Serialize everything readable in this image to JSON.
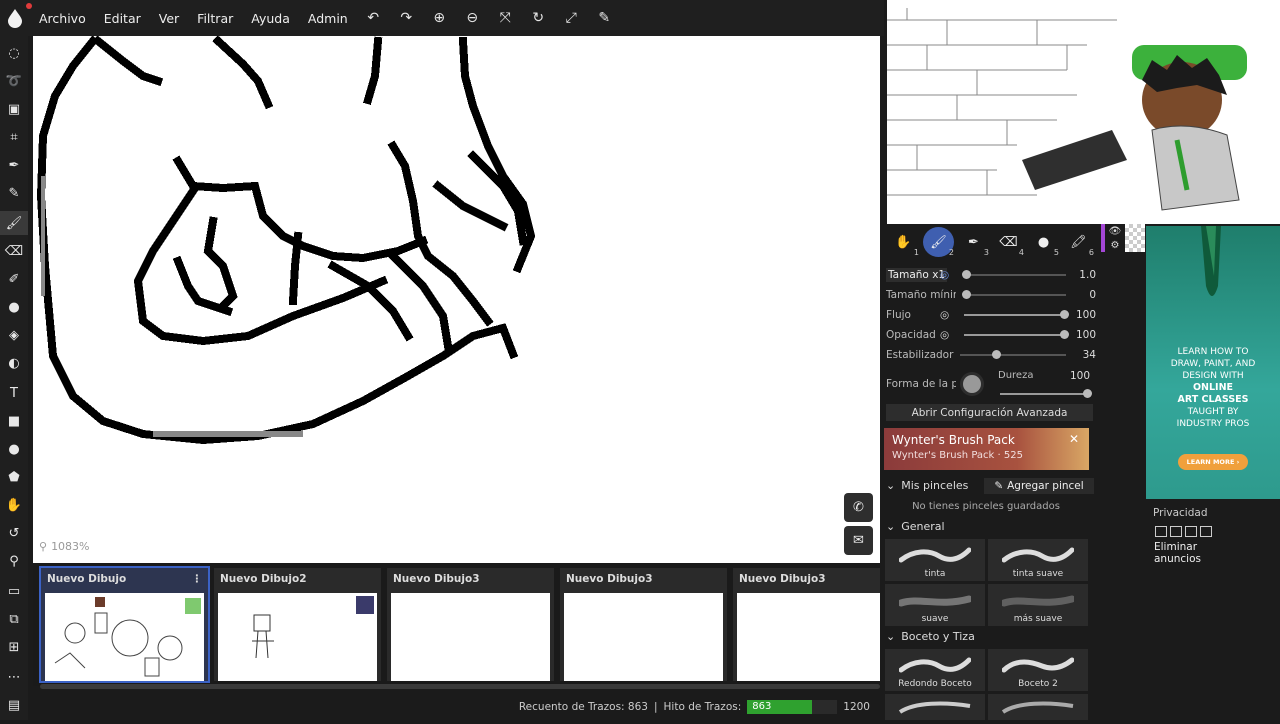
{
  "menu": {
    "items": [
      "Archivo",
      "Editar",
      "Ver",
      "Filtrar",
      "Ayuda",
      "Admin"
    ]
  },
  "icons": {
    "undo": "↶",
    "redo": "↷",
    "zoom_in": "⊕",
    "zoom_out": "⊖",
    "reset": "⤧",
    "rotate": "↻",
    "fullscreen": "⤢",
    "pipette": "✎"
  },
  "canvas": {
    "zoom": "1083%"
  },
  "documents": [
    {
      "title": "Nuevo Dibujo",
      "selected": true
    },
    {
      "title": "Nuevo Dibujo2",
      "selected": false
    },
    {
      "title": "Nuevo Dibujo3",
      "selected": false
    },
    {
      "title": "Nuevo Dibujo3",
      "selected": false
    },
    {
      "title": "Nuevo Dibujo3",
      "selected": false
    }
  ],
  "status": {
    "stroke_count_label": "Recuento de Trazos: 863",
    "stroke_hit_label": "Hito de Trazos:",
    "progress_value": "863",
    "progress_fraction": 0.719,
    "milestone": "1200",
    "progress_color": "#2fa12f"
  },
  "brush_tools": [
    {
      "num": "1"
    },
    {
      "num": "2"
    },
    {
      "num": "3"
    },
    {
      "num": "4"
    },
    {
      "num": "5"
    },
    {
      "num": "6"
    }
  ],
  "sliders": [
    {
      "label": "Tamaño x1",
      "value": "1.0"
    },
    {
      "label": "Tamaño mínimo",
      "value": "0"
    },
    {
      "label": "Flujo",
      "value": "100"
    },
    {
      "label": "Opacidad",
      "value": "100"
    },
    {
      "label": "Estabilizador",
      "value": "34"
    }
  ],
  "tip": {
    "label": "Forma de la pu",
    "hardness_label": "Dureza",
    "hardness_value": "100"
  },
  "advanced_button": "Abrir Configuración Avanzada",
  "promo": {
    "title": "Wynter's Brush Pack",
    "subtitle": "Wynter's Brush Pack · 525",
    "close": "✕"
  },
  "my_brushes": {
    "title": "Mis pinceles",
    "add": "Agregar pincel",
    "empty": "No tienes pinceles guardados"
  },
  "general": {
    "title": "General",
    "brushes": [
      "tinta",
      "tinta suave",
      "suave",
      "más suave"
    ]
  },
  "sketch": {
    "title": "Boceto y Tiza",
    "brushes": [
      "Redondo Boceto",
      "Boceto 2"
    ]
  },
  "ad": {
    "line1": "LEARN HOW TO",
    "line2": "DRAW, PAINT, AND",
    "line3": "DESIGN WITH",
    "line4": "ONLINE",
    "line5": "ART CLASSES",
    "line6": "TAUGHT BY",
    "line7": "INDUSTRY PROS",
    "button": "LEARN MORE ›"
  },
  "privacy": {
    "label": "Privacidad",
    "remove_ads": "Eliminar anuncios"
  },
  "accent": "#3f5fb0"
}
